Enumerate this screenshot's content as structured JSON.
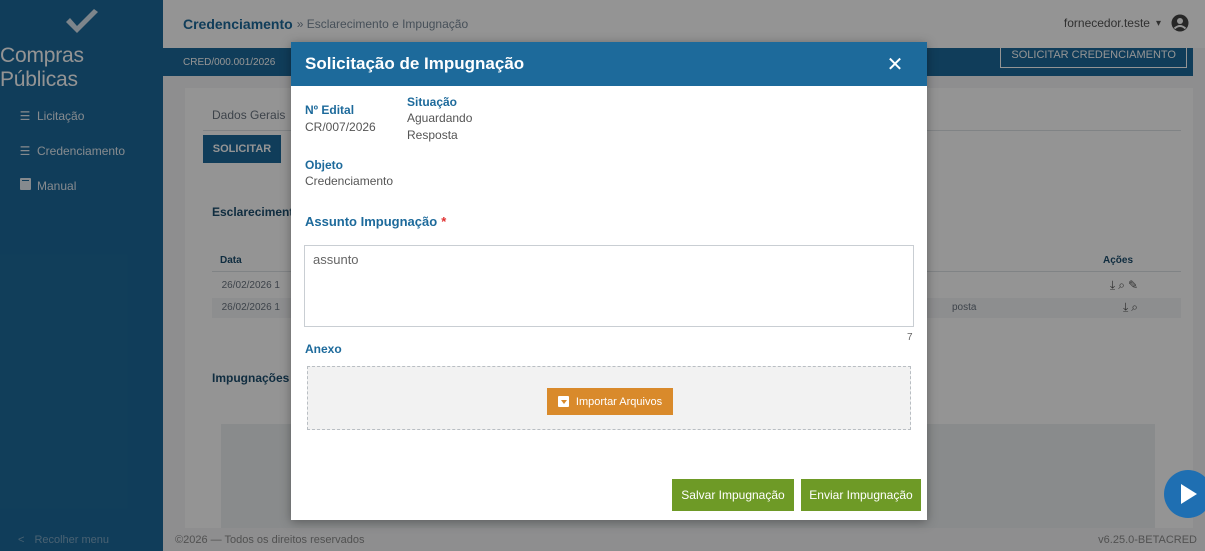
{
  "sidebar": {
    "brand": "Compras Públicas",
    "items": [
      {
        "label": "Licitação",
        "icon": "list-icon"
      },
      {
        "label": "Credenciamento",
        "icon": "list-icon"
      },
      {
        "label": "Manual",
        "icon": "book-icon"
      }
    ],
    "collapse_label": "Recolher menu"
  },
  "header": {
    "title": "Credenciamento",
    "breadcrumb": "» Esclarecimento e Impugnação",
    "user": "fornecedor.teste"
  },
  "subbar": {
    "code": "CRED/000.001/2026",
    "action_label": "SOLICITAR CREDENCIAMENTO"
  },
  "background": {
    "tab_label": "Dados Gerais",
    "solicitar_label": "SOLICITAR",
    "esclarecimentos_title": "Esclarecimentos",
    "impugnacoes_title": "Impugnações",
    "table": {
      "col_data": "Data",
      "col_acoes": "Ações",
      "rows": [
        {
          "date": "26/02/2026 1",
          "status": ""
        },
        {
          "date": "26/02/2026 1",
          "status": "posta"
        }
      ]
    }
  },
  "modal": {
    "title": "Solicitação de Impugnação",
    "edital_label": "Nº Edital",
    "edital_value": "CR/007/2026",
    "situacao_label": "Situação",
    "situacao_value_line1": "Aguardando",
    "situacao_value_line2": "Resposta",
    "objeto_label": "Objeto",
    "objeto_value": "Credenciamento",
    "assunto_label": "Assunto Impugnação",
    "required_mark": "*",
    "assunto_value": "assunto",
    "char_count": "7",
    "anexo_label": "Anexo",
    "import_label": "Importar Arquivos",
    "save_label": "Salvar Impugnação",
    "send_label": "Enviar Impugnação"
  },
  "footer": {
    "copyright": "©2026 — Todos os direitos reservados",
    "version": "v6.25.0-BETACRED"
  },
  "colors": {
    "primary": "#1d6a9b",
    "import_button": "#d98a2b",
    "action_green": "#6e9a26",
    "required": "#e03030"
  }
}
